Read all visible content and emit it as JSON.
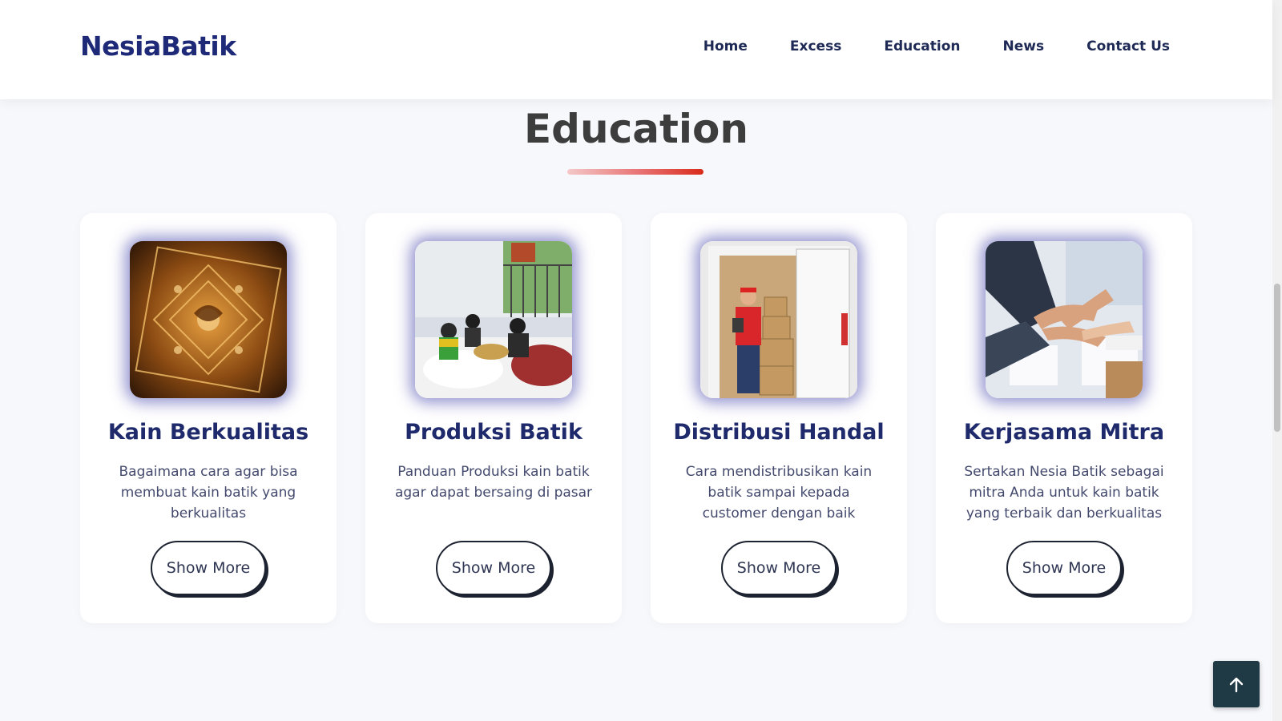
{
  "brand": "NesiaBatik",
  "nav": {
    "items": [
      "Home",
      "Excess",
      "Education",
      "News",
      "Contact Us"
    ]
  },
  "section": {
    "title": "Education"
  },
  "cards": [
    {
      "title": "Kain Berkualitas",
      "description": "Bagaimana cara agar bisa membuat kain batik yang berkualitas",
      "button": "Show More",
      "image_icon": "batik-fabric-image"
    },
    {
      "title": "Produksi Batik",
      "description": "Panduan Produksi kain batik agar dapat bersaing di pasar",
      "button": "Show More",
      "image_icon": "batik-production-image"
    },
    {
      "title": "Distribusi Handal",
      "description": "Cara mendistribusikan kain batik sampai kepada customer dengan baik",
      "button": "Show More",
      "image_icon": "delivery-van-image"
    },
    {
      "title": "Kerjasama Mitra",
      "description": "Sertakan Nesia Batik sebagai mitra Anda untuk kain batik yang terbaik dan berkualitas",
      "button": "Show More",
      "image_icon": "partner-hands-image"
    }
  ],
  "back_to_top": {
    "icon": "arrow-up-icon"
  },
  "colors": {
    "brand": "#1e2a78",
    "accent_underline": "#d92b1a",
    "back_to_top_bg": "#1f3a44"
  }
}
